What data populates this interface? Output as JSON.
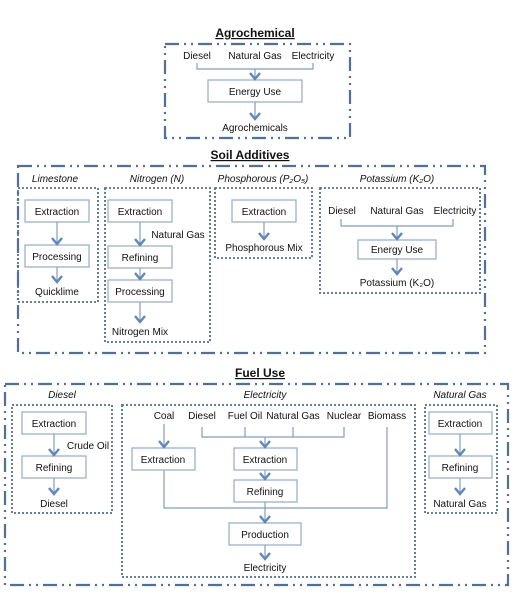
{
  "agrochemical": {
    "title": "Agrochemical",
    "inputs": [
      "Diesel",
      "Natural Gas",
      "Electricity"
    ],
    "process": "Energy Use",
    "output": "Agrochemicals"
  },
  "soil": {
    "title": "Soil Additives",
    "limestone": {
      "label": "Limestone",
      "steps": [
        "Extraction",
        "Processing"
      ],
      "output": "Quicklime"
    },
    "nitrogen": {
      "label": "Nitrogen (N)",
      "steps": [
        "Extraction",
        "Refining",
        "Processing"
      ],
      "input": "Natural Gas",
      "output": "Nitrogen Mix"
    },
    "phosphorous": {
      "label": "Phosphorous (P₂O₅)",
      "steps": [
        "Extraction"
      ],
      "output": "Phosphorous Mix"
    },
    "potassium": {
      "label": "Potassium (K₂O)",
      "inputs": [
        "Diesel",
        "Natural Gas",
        "Electricity"
      ],
      "process": "Energy Use",
      "output": "Potassium (K₂O)"
    }
  },
  "fuel": {
    "title": "Fuel Use",
    "diesel": {
      "label": "Diesel",
      "steps": [
        "Extraction",
        "Refining"
      ],
      "input": "Crude Oil",
      "output": "Diesel"
    },
    "electricity": {
      "label": "Electricity",
      "inputs": [
        "Coal",
        "Diesel",
        "Fuel Oil",
        "Natural Gas",
        "Nuclear",
        "Biomass"
      ],
      "coal_step": "Extraction",
      "steps": [
        "Extraction",
        "Refining"
      ],
      "process": "Production",
      "output": "Electricity"
    },
    "natural_gas": {
      "label": "Natural Gas",
      "steps": [
        "Extraction",
        "Refining"
      ],
      "output": "Natural Gas"
    }
  },
  "colors": {
    "frame": "#4f6f9c",
    "box_border": "#9bb1d4",
    "arrow": "#5f86c4"
  }
}
